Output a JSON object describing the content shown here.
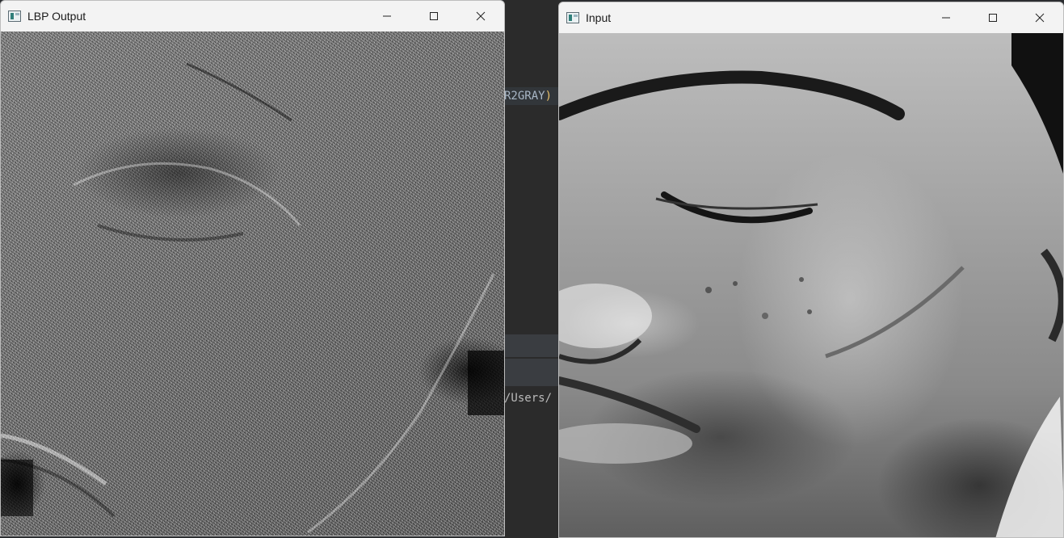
{
  "background_editor": {
    "code_fragment": "R2GRAY",
    "code_paren": ")",
    "path_fragment": "/Users/"
  },
  "windows": [
    {
      "title": "LBP Output",
      "icon": "opencv-window-icon",
      "controls": [
        "minimize-icon",
        "maximize-icon",
        "close-icon"
      ],
      "content": "lbp-texture-image"
    },
    {
      "title": "Input",
      "icon": "opencv-window-icon",
      "controls": [
        "minimize-icon",
        "maximize-icon",
        "close-icon"
      ],
      "content": "grayscale-face-image"
    }
  ],
  "colors": {
    "titlebar": "#f3f3f3",
    "editor_bg": "#2b2b2b",
    "code_text": "#a9b7c6",
    "paren": "#e8bf6a"
  }
}
